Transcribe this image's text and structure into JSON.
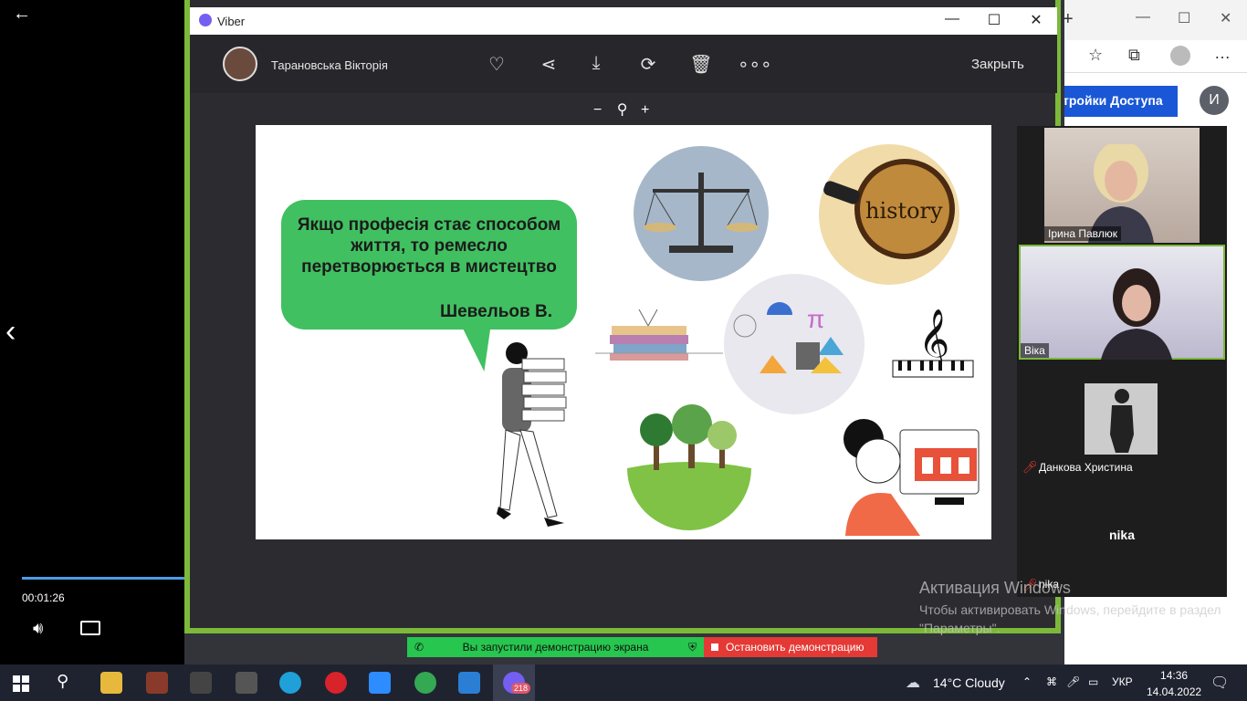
{
  "player": {
    "time": "00:01:26",
    "progress_pct": 0.99
  },
  "viber": {
    "title": "Viber",
    "contact_name": "Тарановська Вікторія",
    "close_label": "Закрыть"
  },
  "slide": {
    "quote": "Якщо професія стає способом життя, то ремесло перетворюється в мистецтво",
    "author": "Шевельов В.",
    "history_word": "history"
  },
  "participants": {
    "p1": "Ірина Павлюк",
    "p2": "Віка",
    "p3": "Данкова Христина",
    "p4_big": "nika",
    "p4_small": "nika"
  },
  "edge": {
    "access_button": "тройки Доступа",
    "avatar_letter": "И"
  },
  "watermark": {
    "line1": "Активация Windows",
    "line2": "Чтобы активировать Windows, перейдите в раздел \"Параметры\"."
  },
  "share": {
    "started": "Вы запустили демонстрацию экрана",
    "stop": "Остановить демонстрацию"
  },
  "taskbar": {
    "weather": "14°C  Cloudy",
    "lang": "УКР",
    "time": "14:36",
    "date": "14.04.2022",
    "viber_badge": "218"
  },
  "colors": {
    "accent_green": "#7cb93a",
    "bubble_green": "#41c061",
    "share_green": "#27c64f",
    "stop_red": "#e53935",
    "edge_blue": "#1a57d6"
  }
}
